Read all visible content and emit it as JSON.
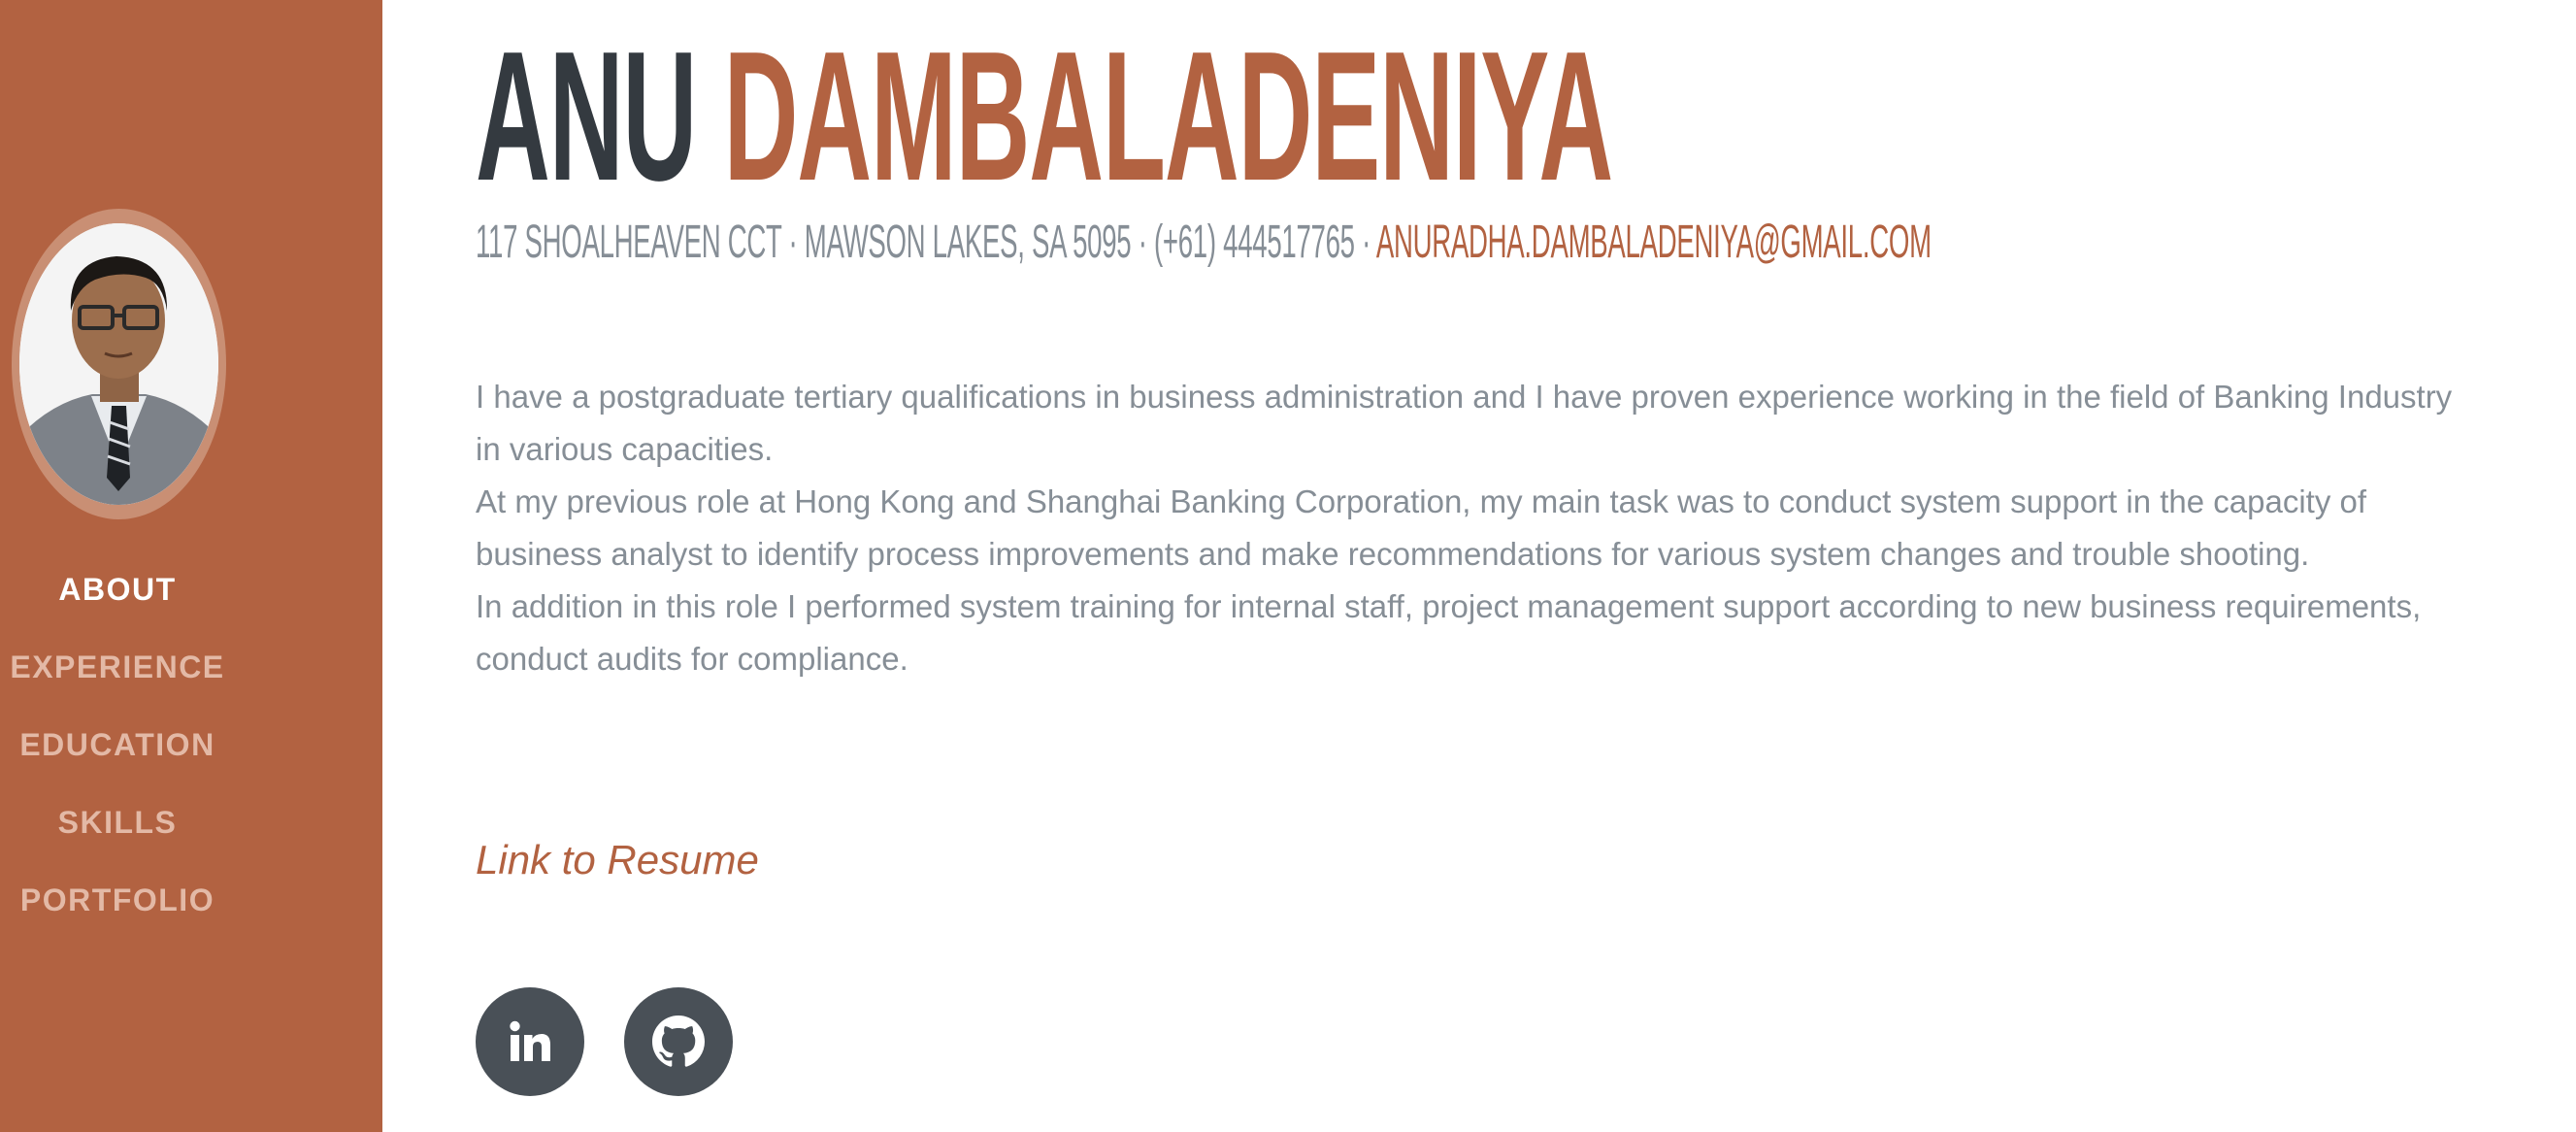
{
  "profile": {
    "first_name": "ANU",
    "last_name": "DAMBALADENIYA",
    "address": "117 SHOALHEAVEN CCT · MAWSON LAKES, SA 5095 · (+61) 444517765 · ",
    "email": "ANURADHA.DAMBALADENIYA@GMAIL.COM"
  },
  "nav": {
    "items": [
      {
        "label": "ABOUT",
        "active": true
      },
      {
        "label": "EXPERIENCE",
        "active": false
      },
      {
        "label": "EDUCATION",
        "active": false
      },
      {
        "label": "SKILLS",
        "active": false
      },
      {
        "label": "PORTFOLIO",
        "active": false
      }
    ]
  },
  "about": {
    "paragraphs": [
      "I have a postgraduate tertiary qualifications in business administration and I have proven experience working in the field of Banking Industry in various capacities.",
      "At my previous role at Hong Kong and Shanghai Banking Corporation, my main task was to conduct system support in the capacity of business analyst to identify process improvements and make recommendations for various system changes and trouble shooting.",
      "In addition in this role I performed system training for internal staff, project management support according to new business requirements, conduct audits for compliance."
    ],
    "resume_link": "Link to Resume"
  },
  "social": {
    "icons": [
      "linkedin-icon",
      "github-icon"
    ]
  },
  "colors": {
    "primary": "#b26241",
    "sidebar": "#b26241",
    "heading_dark": "#343a40",
    "body_text": "#868e96",
    "social_bg": "#495057",
    "nav_inactive": "#e3b9a6",
    "nav_active": "#ffffff"
  }
}
